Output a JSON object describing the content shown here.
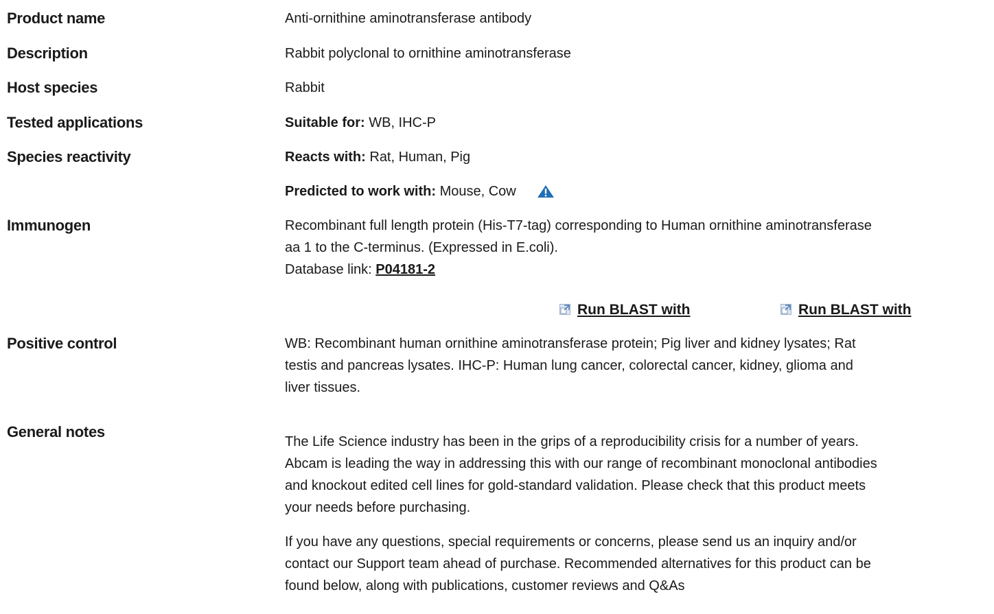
{
  "rows": {
    "product_name": {
      "label": "Product name",
      "value": "Anti-ornithine aminotransferase antibody"
    },
    "description": {
      "label": "Description",
      "value": "Rabbit polyclonal to ornithine aminotransferase"
    },
    "host_species": {
      "label": "Host species",
      "value": "Rabbit"
    },
    "tested_applications": {
      "label": "Tested applications",
      "prefix": "Suitable for:",
      "value": " WB, IHC-P"
    },
    "species_reactivity": {
      "label": "Species reactivity",
      "reacts_prefix": "Reacts with:",
      "reacts_value": " Rat, Human, Pig",
      "predicted_prefix": "Predicted to work with:",
      "predicted_value": " Mouse, Cow",
      "warning_icon": "warning-triangle-icon"
    },
    "immunogen": {
      "label": "Immunogen",
      "line1": "Recombinant full length protein (His-T7-tag) corresponding to Human ornithine aminotransferase",
      "line2": "aa 1 to the C-terminus. (Expressed in E.coli).",
      "db_prefix": "Database link: ",
      "db_link": "P04181-2",
      "blast_1": "Run BLAST with",
      "blast_2": "Run BLAST with",
      "blast_icon": "external-link-icon"
    },
    "positive_control": {
      "label": "Positive control",
      "line1": "WB: Recombinant human ornithine aminotransferase protein; Pig liver and kidney lysates; Rat",
      "line2": "testis and pancreas lysates. IHC-P: Human lung cancer, colorectal cancer, kidney, glioma and",
      "line3": "liver tissues."
    },
    "general_notes": {
      "label": "General notes",
      "p1_l1": "The Life Science industry has been in the grips of a reproducibility crisis for a number of years.",
      "p1_l2": "Abcam is leading the way in addressing this with our range of recombinant monoclonal antibodies",
      "p1_l3": "and knockout edited cell lines for gold-standard validation. Please check that this product meets",
      "p1_l4": "your needs before purchasing.",
      "p2_l1": "If you have any questions, special requirements or concerns, please send us an inquiry and/or",
      "p2_l2": "contact our Support team ahead of purchase. Recommended alternatives for this product can be",
      "p2_l3": "found below, along with publications, customer reviews and Q&As"
    }
  },
  "colors": {
    "text": "#1a1a1a",
    "warning_icon": "#1f6fb5",
    "ext_icon_bg": "#dbe6f3"
  }
}
